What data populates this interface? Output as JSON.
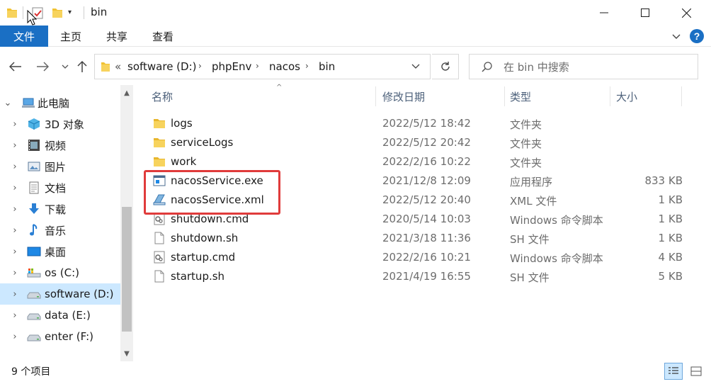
{
  "window": {
    "title": "bin",
    "minimize_icon": "minimize-icon",
    "maximize_icon": "maximize-icon",
    "close_icon": "close-icon"
  },
  "ribbon": {
    "tabs": [
      {
        "label": "文件",
        "active": true
      },
      {
        "label": "主页"
      },
      {
        "label": "共享"
      },
      {
        "label": "查看"
      }
    ],
    "accent_color": "#1a6fc4"
  },
  "address": {
    "overflow": "«",
    "crumbs": [
      "software (D:)",
      "phpEnv",
      "nacos",
      "bin"
    ]
  },
  "search": {
    "placeholder": "在 bin 中搜索"
  },
  "nav_pane": {
    "items": [
      {
        "label": "此电脑",
        "icon": "computer-icon",
        "expanded": true
      },
      {
        "label": "3D 对象",
        "icon": "3d-objects-icon"
      },
      {
        "label": "视频",
        "icon": "video-icon"
      },
      {
        "label": "图片",
        "icon": "pictures-icon"
      },
      {
        "label": "文档",
        "icon": "documents-icon"
      },
      {
        "label": "下载",
        "icon": "download-icon"
      },
      {
        "label": "音乐",
        "icon": "music-icon"
      },
      {
        "label": "桌面",
        "icon": "desktop-icon"
      },
      {
        "label": "os (C:)",
        "icon": "os-drive-icon"
      },
      {
        "label": "software (D:)",
        "icon": "drive-icon",
        "selected": true
      },
      {
        "label": "data (E:)",
        "icon": "drive-icon"
      },
      {
        "label": "enter (F:)",
        "icon": "drive-icon"
      }
    ]
  },
  "file_list": {
    "columns": {
      "name": "名称",
      "date": "修改日期",
      "type": "类型",
      "size": "大小"
    },
    "rows": [
      {
        "name": "logs",
        "date": "2022/5/12 18:42",
        "type": "文件夹",
        "size": "",
        "icon": "folder-icon"
      },
      {
        "name": "serviceLogs",
        "date": "2022/5/12 20:42",
        "type": "文件夹",
        "size": "",
        "icon": "folder-icon"
      },
      {
        "name": "work",
        "date": "2022/2/16 10:22",
        "type": "文件夹",
        "size": "",
        "icon": "folder-icon"
      },
      {
        "name": "nacosService.exe",
        "date": "2021/12/8 12:09",
        "type": "应用程序",
        "size": "833 KB",
        "icon": "exe-icon"
      },
      {
        "name": "nacosService.xml",
        "date": "2022/5/12 20:40",
        "type": "XML 文件",
        "size": "1 KB",
        "icon": "xml-icon"
      },
      {
        "name": "shutdown.cmd",
        "date": "2020/5/14 10:03",
        "type": "Windows 命令脚本",
        "size": "1 KB",
        "icon": "cmd-script-icon"
      },
      {
        "name": "shutdown.sh",
        "date": "2021/3/18 11:36",
        "type": "SH 文件",
        "size": "1 KB",
        "icon": "file-icon"
      },
      {
        "name": "startup.cmd",
        "date": "2022/2/16 10:21",
        "type": "Windows 命令脚本",
        "size": "4 KB",
        "icon": "cmd-script-icon"
      },
      {
        "name": "startup.sh",
        "date": "2021/4/19 16:55",
        "type": "SH 文件",
        "size": "5 KB",
        "icon": "file-icon"
      }
    ],
    "highlight_color": "#e03b3b"
  },
  "status": {
    "count": "9 个项目",
    "view_icons": [
      "details-view-icon",
      "large-icons-view-icon"
    ]
  }
}
